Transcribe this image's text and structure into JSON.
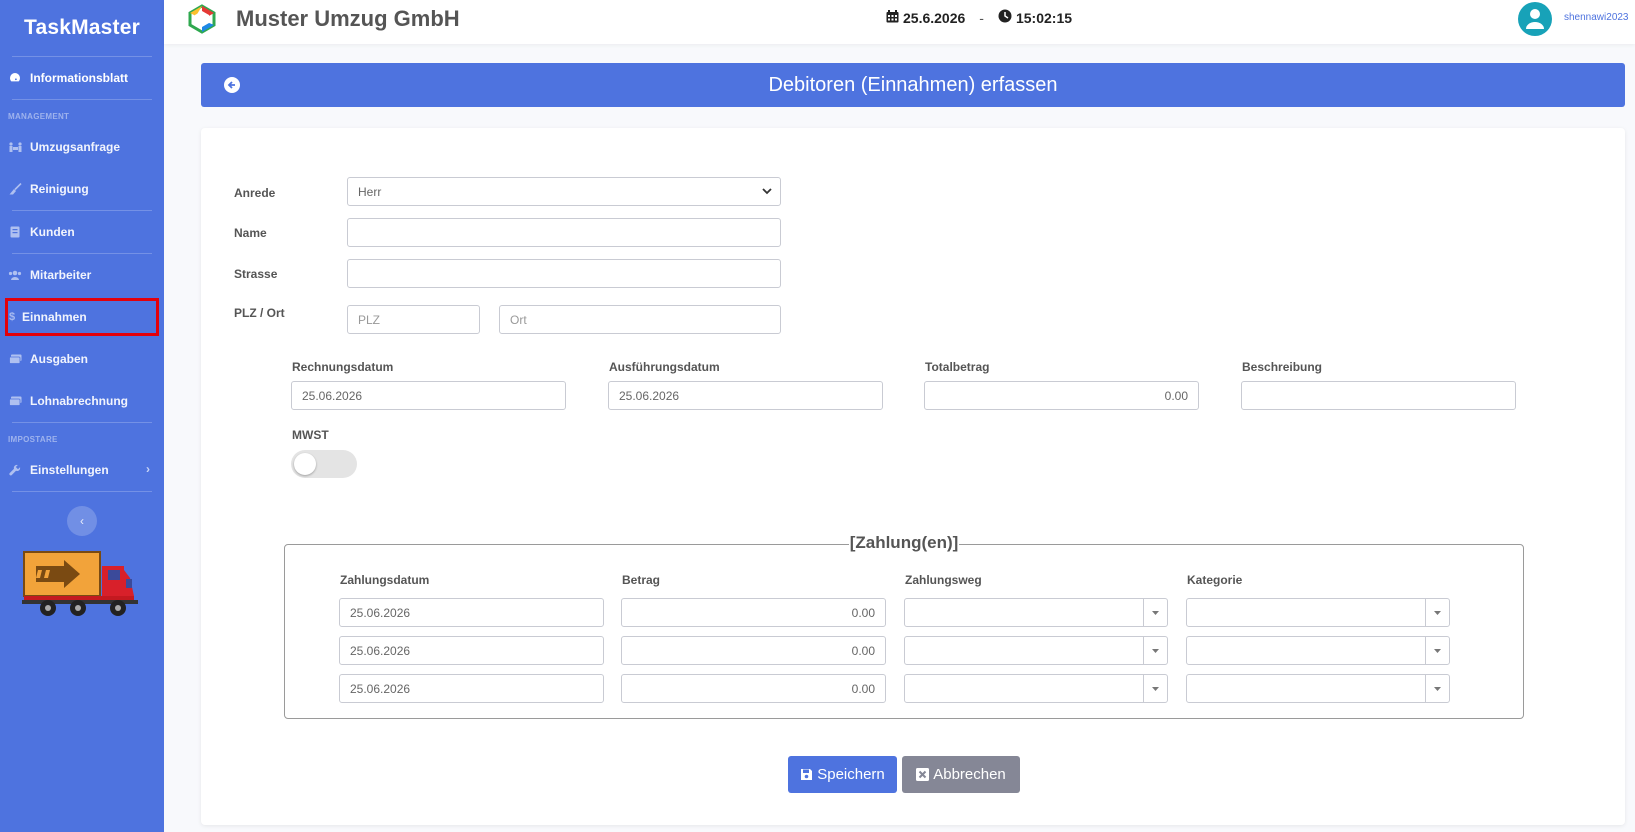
{
  "sidebar": {
    "brand": "TaskMaster",
    "dashboard": "Informationsblatt",
    "section_management": "MANAGEMENT",
    "items": [
      {
        "label": "Umzugsanfrage"
      },
      {
        "label": "Reinigung"
      },
      {
        "label": "Kunden"
      },
      {
        "label": "Mitarbeiter"
      },
      {
        "label": "Einnahmen"
      },
      {
        "label": "Ausgaben"
      },
      {
        "label": "Lohnabrechnung"
      }
    ],
    "section_settings": "IMPOSTARE",
    "settings": "Einstellungen",
    "collapse_icon": "chevron-left-icon"
  },
  "topbar": {
    "company": "Muster Umzug GmbH",
    "date": "25.6.2026",
    "separator": "-",
    "time": "15:02:15",
    "username": "shennawi2023"
  },
  "page": {
    "title": "Debitoren (Einnahmen) erfassen"
  },
  "form": {
    "anrede_label": "Anrede",
    "anrede_value": "Herr",
    "name_label": "Name",
    "name_value": "",
    "strasse_label": "Strasse",
    "strasse_value": "",
    "plzort_label": "PLZ / Ort",
    "plz_placeholder": "PLZ",
    "ort_placeholder": "Ort",
    "rechnungsdatum_label": "Rechnungsdatum",
    "rechnungsdatum_value": "25.06.2026",
    "ausfuehrungsdatum_label": "Ausführungsdatum",
    "ausfuehrungsdatum_value": "25.06.2026",
    "totalbetrag_label": "Totalbetrag",
    "totalbetrag_value": "0.00",
    "beschreibung_label": "Beschreibung",
    "beschreibung_value": "",
    "mwst_label": "MWST",
    "mwst_on": false
  },
  "payments": {
    "legend": "[Zahlung(en)]",
    "headers": [
      "Zahlungsdatum",
      "Betrag",
      "Zahlungsweg",
      "Kategorie"
    ],
    "rows": [
      {
        "date": "25.06.2026",
        "amount": "0.00",
        "method": "",
        "category": ""
      },
      {
        "date": "25.06.2026",
        "amount": "0.00",
        "method": "",
        "category": ""
      },
      {
        "date": "25.06.2026",
        "amount": "0.00",
        "method": "",
        "category": ""
      }
    ]
  },
  "buttons": {
    "save": "Speichern",
    "cancel": "Abbrechen"
  },
  "colors": {
    "primary": "#4e73df",
    "secondary": "#858796",
    "highlight": "#e3000b"
  }
}
